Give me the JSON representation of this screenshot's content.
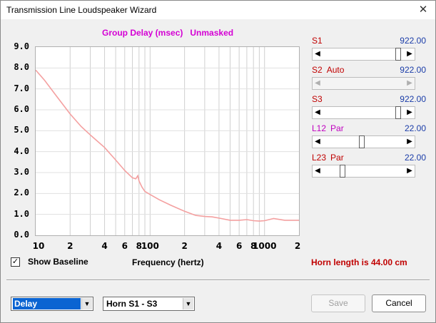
{
  "window": {
    "title": "Transmission Line Loudspeaker Wizard",
    "close_glyph": "✕"
  },
  "chart_title": {
    "quantity": "Group Delay (msec)",
    "mode": "Unmasked"
  },
  "chart_data": {
    "type": "line",
    "title": "Group Delay (msec)   Unmasked",
    "xlabel": "Frequency (hertz)",
    "ylabel": "",
    "x_scale": "log",
    "xlim": [
      10,
      2000
    ],
    "ylim": [
      0,
      9
    ],
    "grid": true,
    "ytick_labels": [
      "9.0",
      "8.0",
      "7.0",
      "6.0",
      "5.0",
      "4.0",
      "3.0",
      "2.0",
      "1.0",
      "0.0"
    ],
    "xtick_labels": [
      {
        "v": 10,
        "t": "10"
      },
      {
        "v": 20,
        "t": "2"
      },
      {
        "v": 40,
        "t": "4"
      },
      {
        "v": 60,
        "t": "6"
      },
      {
        "v": 80,
        "t": "8"
      },
      {
        "v": 100,
        "t": "100"
      },
      {
        "v": 200,
        "t": "2"
      },
      {
        "v": 400,
        "t": "4"
      },
      {
        "v": 600,
        "t": "6"
      },
      {
        "v": 800,
        "t": "8"
      },
      {
        "v": 1000,
        "t": "1000"
      },
      {
        "v": 2000,
        "t": "2"
      }
    ],
    "series": [
      {
        "color": "#f4a0a0",
        "x": [
          10,
          12,
          15,
          20,
          25,
          30,
          40,
          50,
          60,
          70,
          75,
          78,
          80,
          85,
          90,
          100,
          120,
          150,
          200,
          250,
          300,
          350,
          400,
          500,
          600,
          700,
          800,
          900,
          1000,
          1200,
          1500,
          2000
        ],
        "y": [
          7.9,
          7.4,
          6.7,
          5.8,
          5.2,
          4.8,
          4.2,
          3.6,
          3.1,
          2.75,
          2.7,
          2.85,
          2.6,
          2.3,
          2.1,
          1.95,
          1.7,
          1.45,
          1.15,
          0.95,
          0.9,
          0.88,
          0.82,
          0.72,
          0.72,
          0.75,
          0.7,
          0.68,
          0.7,
          0.8,
          0.72,
          0.72
        ]
      }
    ]
  },
  "sliders": [
    {
      "label": "S1",
      "mode": "",
      "value": "922.00",
      "position": 0.95,
      "enabled": true,
      "label_color": "#c00000"
    },
    {
      "label": "S2",
      "mode": "Auto",
      "value": "922.00",
      "position": null,
      "enabled": false,
      "label_color": "#c00000"
    },
    {
      "label": "S3",
      "mode": "",
      "value": "922.00",
      "position": 0.95,
      "enabled": true,
      "label_color": "#c00000"
    },
    {
      "label": "L12",
      "mode": "Par",
      "value": "22.00",
      "position": 0.48,
      "enabled": true,
      "label_color": "#c000c0"
    },
    {
      "label": "L23",
      "mode": "Par",
      "value": "22.00",
      "position": 0.22,
      "enabled": true,
      "label_color": "#c00000"
    }
  ],
  "show_baseline": {
    "label": "Show Baseline",
    "checked": true
  },
  "x_axis_label": "Frequency (hertz)",
  "horn_length": "Horn length is 44.00 cm",
  "plot_select": {
    "value": "Delay"
  },
  "range_select": {
    "value": "Horn S1 - S3"
  },
  "buttons": {
    "save": "Save",
    "cancel": "Cancel"
  }
}
